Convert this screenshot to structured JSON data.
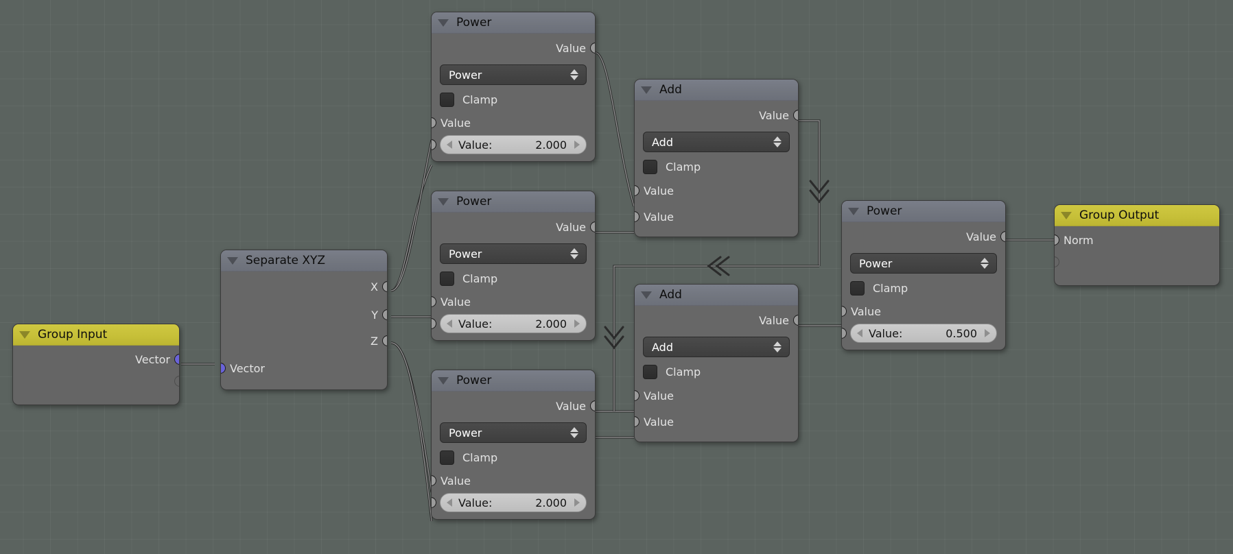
{
  "app": {
    "editor": "blender-node-editor",
    "background_color": "#5b635f",
    "grid_color": "#646c68"
  },
  "colors": {
    "header_math": "#72767f",
    "header_group": "#c6bf38",
    "node_body": "#676767",
    "socket_value": "#9b9b9b",
    "socket_vector": "#6a63d8",
    "wire": "#2b2b2b",
    "slider_bg": "#c5c5c5"
  },
  "nodes": [
    {
      "id": "group_input",
      "title": "Group Input",
      "type": "group",
      "outputs": [
        {
          "label": "Vector",
          "socket": "vector"
        },
        {
          "label": "",
          "socket": "empty"
        }
      ]
    },
    {
      "id": "separate_xyz",
      "title": "Separate XYZ",
      "type": "vector",
      "outputs": [
        {
          "label": "X",
          "socket": "value"
        },
        {
          "label": "Y",
          "socket": "value"
        },
        {
          "label": "Z",
          "socket": "value"
        }
      ],
      "inputs": [
        {
          "label": "Vector",
          "socket": "vector"
        }
      ]
    },
    {
      "id": "power_x",
      "title": "Power",
      "type": "math",
      "outputs": [
        {
          "label": "Value",
          "socket": "value"
        }
      ],
      "operation": "Power",
      "clamp_label": "Clamp",
      "clamp_checked": false,
      "inputs": [
        {
          "label": "Value",
          "socket": "value"
        },
        {
          "label": "Value:",
          "socket": "value",
          "value": "2.000"
        }
      ]
    },
    {
      "id": "power_y",
      "title": "Power",
      "type": "math",
      "outputs": [
        {
          "label": "Value",
          "socket": "value"
        }
      ],
      "operation": "Power",
      "clamp_label": "Clamp",
      "clamp_checked": false,
      "inputs": [
        {
          "label": "Value",
          "socket": "value"
        },
        {
          "label": "Value:",
          "socket": "value",
          "value": "2.000"
        }
      ]
    },
    {
      "id": "power_z",
      "title": "Power",
      "type": "math",
      "outputs": [
        {
          "label": "Value",
          "socket": "value"
        }
      ],
      "operation": "Power",
      "clamp_label": "Clamp",
      "clamp_checked": false,
      "inputs": [
        {
          "label": "Value",
          "socket": "value"
        },
        {
          "label": "Value:",
          "socket": "value",
          "value": "2.000"
        }
      ]
    },
    {
      "id": "add_top",
      "title": "Add",
      "type": "math",
      "outputs": [
        {
          "label": "Value",
          "socket": "value"
        }
      ],
      "operation": "Add",
      "clamp_label": "Clamp",
      "clamp_checked": false,
      "inputs": [
        {
          "label": "Value",
          "socket": "value"
        },
        {
          "label": "Value",
          "socket": "value"
        }
      ]
    },
    {
      "id": "add_bottom",
      "title": "Add",
      "type": "math",
      "outputs": [
        {
          "label": "Value",
          "socket": "value"
        }
      ],
      "operation": "Add",
      "clamp_label": "Clamp",
      "clamp_checked": false,
      "inputs": [
        {
          "label": "Value",
          "socket": "value"
        },
        {
          "label": "Value",
          "socket": "value"
        }
      ]
    },
    {
      "id": "power_sqrt",
      "title": "Power",
      "type": "math",
      "outputs": [
        {
          "label": "Value",
          "socket": "value"
        }
      ],
      "operation": "Power",
      "clamp_label": "Clamp",
      "clamp_checked": false,
      "inputs": [
        {
          "label": "Value",
          "socket": "value"
        },
        {
          "label": "Value:",
          "socket": "value",
          "value": "0.500"
        }
      ]
    },
    {
      "id": "group_output",
      "title": "Group Output",
      "type": "group",
      "inputs": [
        {
          "label": "Norm",
          "socket": "value"
        },
        {
          "label": "",
          "socket": "empty"
        }
      ]
    }
  ],
  "node_text": {
    "group_input": {
      "title": "Group Input",
      "out_vector": "Vector"
    },
    "separate_xyz": {
      "title": "Separate XYZ",
      "x": "X",
      "y": "Y",
      "z": "Z",
      "in_vector": "Vector"
    },
    "power_x": {
      "title": "Power",
      "out_value": "Value",
      "operation": "Power",
      "clamp": "Clamp",
      "in_value": "Value",
      "slider_label": "Value:",
      "slider_value": "2.000"
    },
    "power_y": {
      "title": "Power",
      "out_value": "Value",
      "operation": "Power",
      "clamp": "Clamp",
      "in_value": "Value",
      "slider_label": "Value:",
      "slider_value": "2.000"
    },
    "power_z": {
      "title": "Power",
      "out_value": "Value",
      "operation": "Power",
      "clamp": "Clamp",
      "in_value": "Value",
      "slider_label": "Value:",
      "slider_value": "2.000"
    },
    "add_top": {
      "title": "Add",
      "out_value": "Value",
      "operation": "Add",
      "clamp": "Clamp",
      "in_value_1": "Value",
      "in_value_2": "Value"
    },
    "add_bottom": {
      "title": "Add",
      "out_value": "Value",
      "operation": "Add",
      "clamp": "Clamp",
      "in_value_1": "Value",
      "in_value_2": "Value"
    },
    "power_sqrt": {
      "title": "Power",
      "out_value": "Value",
      "operation": "Power",
      "clamp": "Clamp",
      "in_value": "Value",
      "slider_label": "Value:",
      "slider_value": "0.500"
    },
    "group_output": {
      "title": "Group Output",
      "in_norm": "Norm"
    }
  }
}
